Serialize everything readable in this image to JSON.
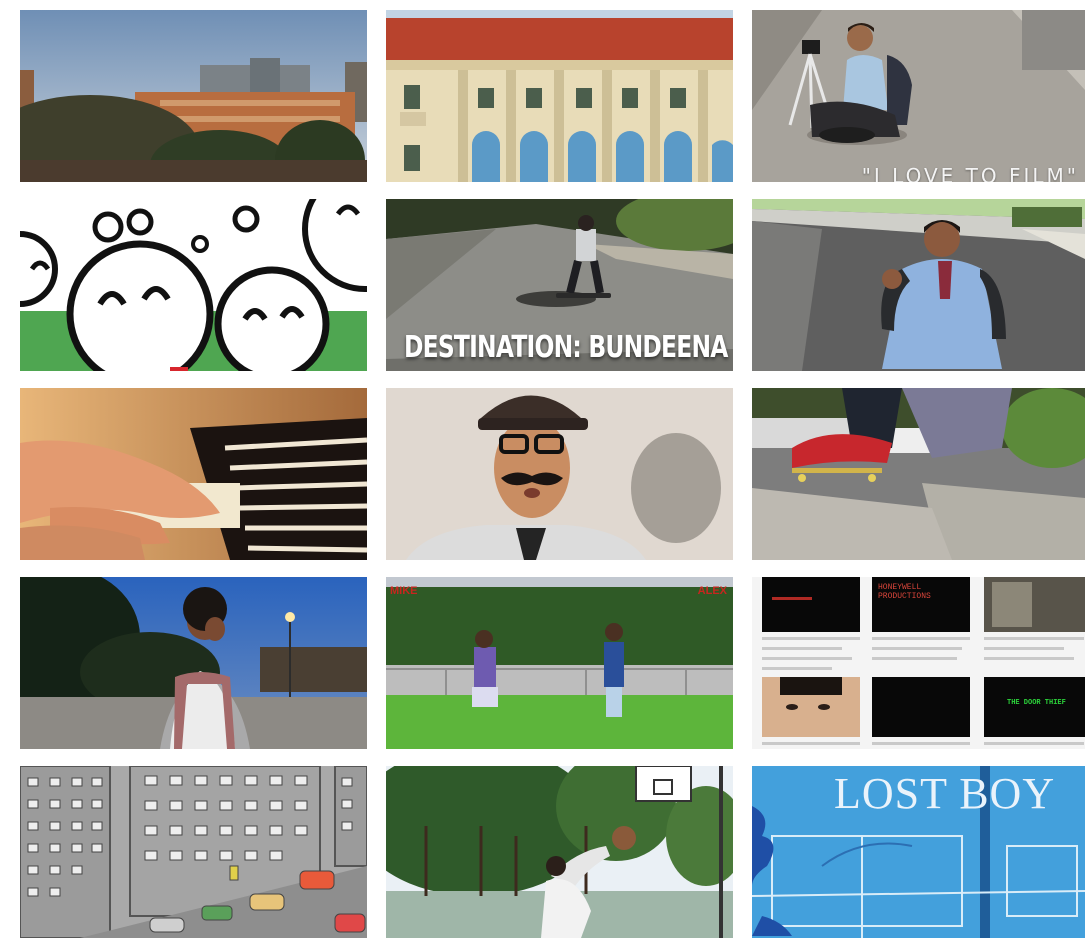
{
  "gallery": {
    "tiles": [
      {
        "id": "city-skyline"
      },
      {
        "id": "heritage-building"
      },
      {
        "id": "boy-with-camera",
        "caption": "\"I LOVE TO FILM\""
      },
      {
        "id": "cartoon-faces"
      },
      {
        "id": "skateboarder",
        "caption": "DESTINATION: BUNDEENA"
      },
      {
        "id": "schoolboy-street"
      },
      {
        "id": "piano-hands"
      },
      {
        "id": "mustache-man"
      },
      {
        "id": "skateboard-ledge"
      },
      {
        "id": "boy-at-dusk"
      },
      {
        "id": "field-duel",
        "caption_left": "MIKE",
        "caption_right": "ALEX"
      },
      {
        "id": "production-collage",
        "caption_top": "HONEYWELL PRODUCTIONS",
        "caption_bottom": "THE DOOR THIEF"
      },
      {
        "id": "cartoon-city"
      },
      {
        "id": "basketball-court"
      },
      {
        "id": "lost-boy",
        "caption": "LOST BOY"
      }
    ]
  },
  "colors": {
    "sky_blue": "#8aa6c2",
    "field_green": "#4f9a34",
    "lost_boy_blue": "#3d9ad8",
    "caption_red": "#c8261f"
  }
}
